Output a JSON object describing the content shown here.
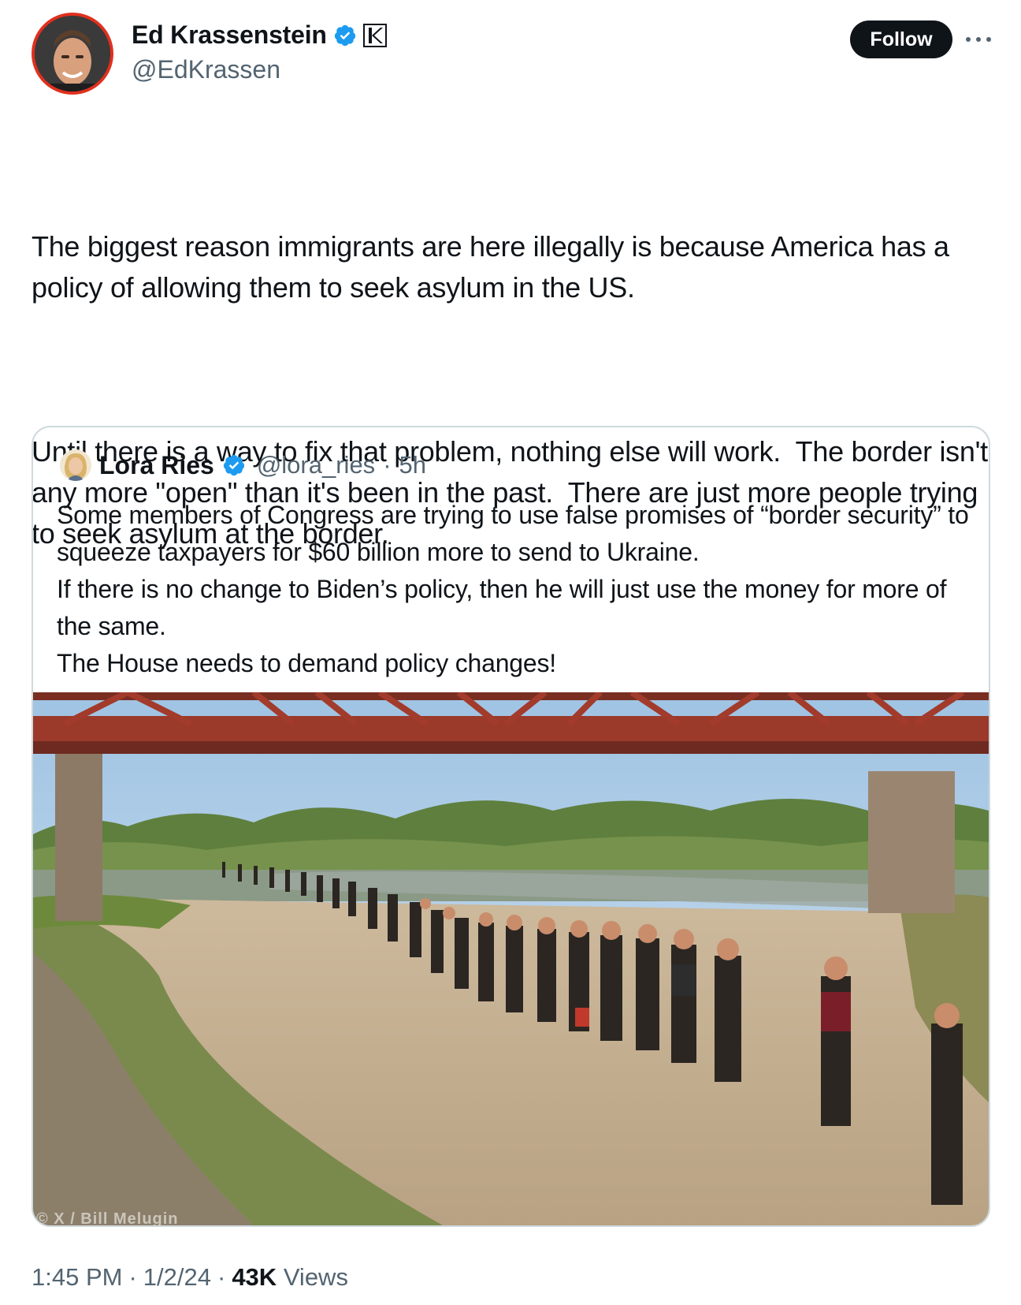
{
  "author": {
    "display_name": "Ed Krassenstein",
    "handle": "@EdKrassen",
    "follow_label": "Follow"
  },
  "tweet": {
    "paragraphs": [
      "The biggest reason immigrants are here illegally is because America has a policy of allowing them to seek asylum in the US.",
      "Until there is a way to fix that problem, nothing else will work.  The border isn't any more \"open\" than it's been in the past.  There are just more people trying to seek asylum at the border."
    ]
  },
  "quoted_tweet": {
    "display_name": "Lora Ries",
    "handle": "@lora_ries",
    "separator": "·",
    "time": "5h",
    "lines": [
      "Some members of Congress are trying to use false promises of “border security” to squeeze taxpayers for $60 billion more to send to Ukraine.",
      "If there is no change to Biden’s policy, then he will just use the money for more of the same.",
      "The House needs to demand policy changes!"
    ],
    "photo_watermark": "© X / Bill Melugin"
  },
  "meta": {
    "time": "1:45 PM",
    "sep1": "·",
    "date": "1/2/24",
    "sep2": "·",
    "views_count": "43K",
    "views_label": "Views"
  },
  "colors": {
    "avatar_ring": "#e0301e",
    "verified_blue": "#1d9bf0",
    "follow_bg": "#0f1419",
    "secondary_text": "#536471",
    "card_border": "#cfd9de"
  },
  "icons": [
    "verified-badge-icon",
    "affiliate-badge-icon",
    "more-options-icon"
  ]
}
